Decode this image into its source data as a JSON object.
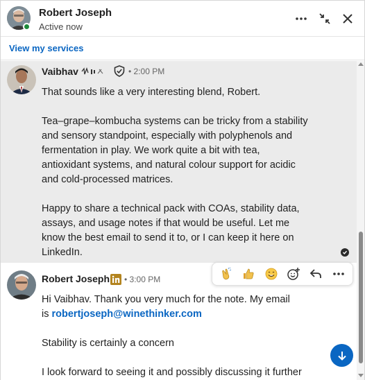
{
  "header": {
    "contact_name": "Robert Joseph",
    "status": "Active now",
    "presence_color": "#1d8a3b",
    "actions": [
      "more-icon",
      "minimize-icon",
      "close-icon"
    ]
  },
  "services_link": "View my services",
  "messages": [
    {
      "sender": "Vaibhav",
      "time": "2:00 PM",
      "badges": [
        "verified-shield-icon"
      ],
      "paragraphs": [
        [
          "That sounds like a very interesting blend, Robert."
        ],
        [
          "Tea–grape–kombucha systems can be tricky from a stability",
          "and sensory standpoint, especially with polyphenols and",
          "fermentation in play. We work quite a bit with tea,",
          "antioxidant systems, and natural colour support for acidic",
          "and cold-processed matrices."
        ],
        [
          "Happy to share a technical pack with COAs, stability data,",
          "assays, and usage notes if that would be useful. Let me",
          "know the best email to send it to, or I can keep it here on",
          "LinkedIn."
        ]
      ],
      "read": true
    },
    {
      "sender": "Robert Joseph",
      "time": "3:00 PM",
      "badges": [
        "linkedin-icon"
      ],
      "line1": "Hi Vaibhav. Thank you very much for the note. My email",
      "line2_prefix": "is ",
      "email": "robertjoseph@winethinker.com",
      "line3": "Stability is certainly a concern",
      "line4": "I look forward to seeing it and possibly discussing it further"
    }
  ],
  "reaction_bar": [
    "clap-icon",
    "thumbs-up-icon",
    "smile-icon",
    "add-reaction-icon",
    "reply-icon",
    "more-icon"
  ],
  "accent_color": "#0a66c2"
}
